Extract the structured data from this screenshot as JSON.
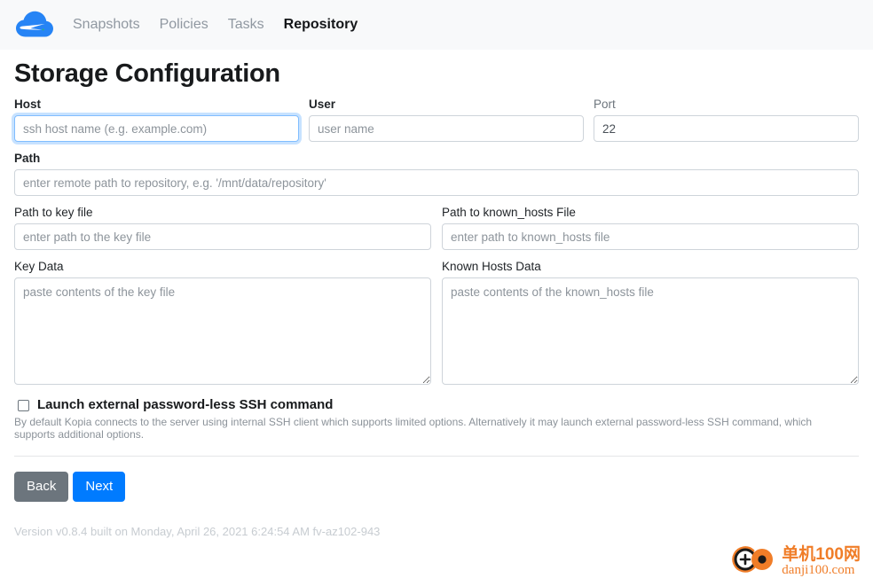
{
  "navbar": {
    "logo_icon": "kopia-cloud-logo-icon",
    "links": [
      {
        "label": "Snapshots",
        "active": false
      },
      {
        "label": "Policies",
        "active": false
      },
      {
        "label": "Tasks",
        "active": false
      },
      {
        "label": "Repository",
        "active": true
      }
    ]
  },
  "page": {
    "title": "Storage Configuration"
  },
  "form": {
    "host": {
      "label": "Host",
      "placeholder": "ssh host name (e.g. example.com)",
      "value": "",
      "focused": true
    },
    "user": {
      "label": "User",
      "placeholder": "user name",
      "value": ""
    },
    "port": {
      "label": "Port",
      "placeholder": "",
      "value": "22"
    },
    "path": {
      "label": "Path",
      "placeholder": "enter remote path to repository, e.g. '/mnt/data/repository'",
      "value": ""
    },
    "key_file_path": {
      "label": "Path to key file",
      "placeholder": "enter path to the key file",
      "value": ""
    },
    "known_hosts_path": {
      "label": "Path to known_hosts File",
      "placeholder": "enter path to known_hosts file",
      "value": ""
    },
    "key_data": {
      "label": "Key Data",
      "placeholder": "paste contents of the key file",
      "value": ""
    },
    "known_hosts_data": {
      "label": "Known Hosts Data",
      "placeholder": "paste contents of the known_hosts file",
      "value": ""
    },
    "external_ssh": {
      "label": "Launch external password-less SSH command",
      "checked": false,
      "help": "By default Kopia connects to the server using internal SSH client which supports limited options. Alternatively it may launch external password-less SSH command, which supports additional options."
    }
  },
  "buttons": {
    "back": "Back",
    "next": "Next"
  },
  "footer": {
    "version": "Version v0.8.4 built on Monday, April 26, 2021 6:24:54 AM fv-az102-943"
  },
  "watermark": {
    "cn": "单机100网",
    "en": "danji100.com",
    "color": "#f07d28"
  },
  "colors": {
    "primary": "#007bff",
    "secondary": "#6c757d",
    "navbar_bg": "#f8f9fa",
    "focus_border": "#80bdff"
  }
}
